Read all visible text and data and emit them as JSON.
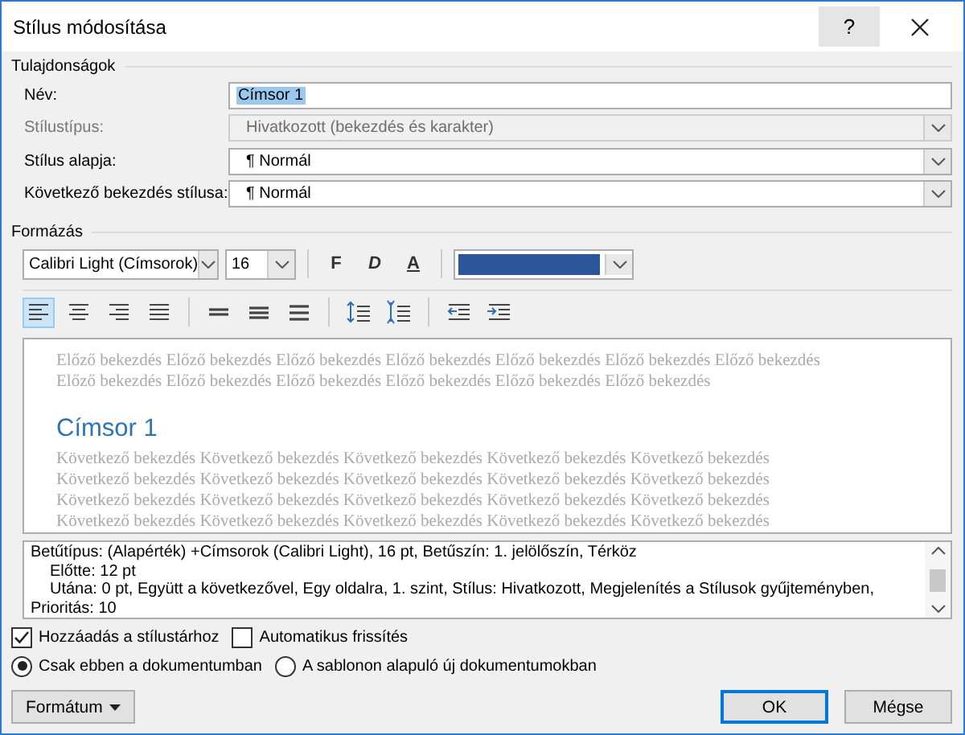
{
  "window": {
    "title": "Stílus módosítása",
    "help": "?"
  },
  "properties": {
    "title": "Tulajdonságok",
    "rows": [
      {
        "label": "Név:",
        "kind": "text",
        "value": "Címsor 1",
        "disabled": false
      },
      {
        "label": "Stílustípus:",
        "kind": "select",
        "value": "Hivatkozott (bekezdés és karakter)",
        "disabled": true
      },
      {
        "label": "Stílus alapja:",
        "kind": "select",
        "value": "¶  Normál",
        "disabled": false
      },
      {
        "label": "Következő bekezdés stílusa:",
        "kind": "select",
        "value": "¶  Normál",
        "disabled": false
      }
    ]
  },
  "formatting": {
    "title": "Formázás",
    "font": "Calibri Light (Címsorok)",
    "size": "16",
    "bold": "F",
    "italic": "D",
    "underline": "A",
    "color": "#2b579a",
    "align_buttons": [
      {
        "kind": "align-left",
        "selected": true
      },
      {
        "kind": "align-center",
        "selected": false
      },
      {
        "kind": "align-right",
        "selected": false
      },
      {
        "kind": "justify",
        "selected": false
      },
      {
        "kind": "single-spacing",
        "selected": false
      },
      {
        "kind": "one-half-spacing",
        "selected": false
      },
      {
        "kind": "double-spacing",
        "selected": false
      },
      {
        "kind": "space-before",
        "selected": false
      },
      {
        "kind": "space-after",
        "selected": false
      },
      {
        "kind": "decrease-indent",
        "selected": false
      },
      {
        "kind": "increase-indent",
        "selected": false
      }
    ]
  },
  "preview": {
    "previous": [
      "Előző bekezdés Előző bekezdés Előző bekezdés Előző bekezdés Előző bekezdés Előző bekezdés Előző bekezdés",
      "Előző bekezdés Előző bekezdés Előző bekezdés Előző bekezdés Előző bekezdés Előző bekezdés"
    ],
    "heading": "Címsor 1",
    "following": [
      "Következő bekezdés Következő bekezdés Következő bekezdés Következő bekezdés Következő bekezdés",
      "Következő bekezdés Következő bekezdés Következő bekezdés Következő bekezdés Következő bekezdés",
      "Következő bekezdés Következő bekezdés Következő bekezdés Következő bekezdés Következő bekezdés",
      "Következő bekezdés Következő bekezdés Következő bekezdés Következő bekezdés Következő bekezdés"
    ]
  },
  "description": [
    {
      "kind": "main",
      "text": "Betűtípus: (Alapérték) +Címsorok (Calibri Light), 16 pt, Betűszín: 1. jelölőszín, Térköz"
    },
    {
      "kind": "sub",
      "text": "Előtte:  12 pt"
    },
    {
      "kind": "sub",
      "text": "Utána:  0 pt, Együtt a következővel, Egy oldalra, 1. szint, Stílus: Hivatkozott, Megjelenítés a Stílusok gyűjteményben, Prioritás: 10"
    }
  ],
  "checkboxes": [
    {
      "label": "Hozzáadás a stílustárhoz",
      "checked": true
    },
    {
      "label": "Automatikus frissítés",
      "checked": false
    }
  ],
  "radios": [
    {
      "label": "Csak ebben a dokumentumban",
      "selected": true
    },
    {
      "label": "A sablonon alapuló új dokumentumokban",
      "selected": false
    }
  ],
  "buttons": {
    "format": "Formátum",
    "ok": "OK",
    "cancel": "Mégse"
  }
}
